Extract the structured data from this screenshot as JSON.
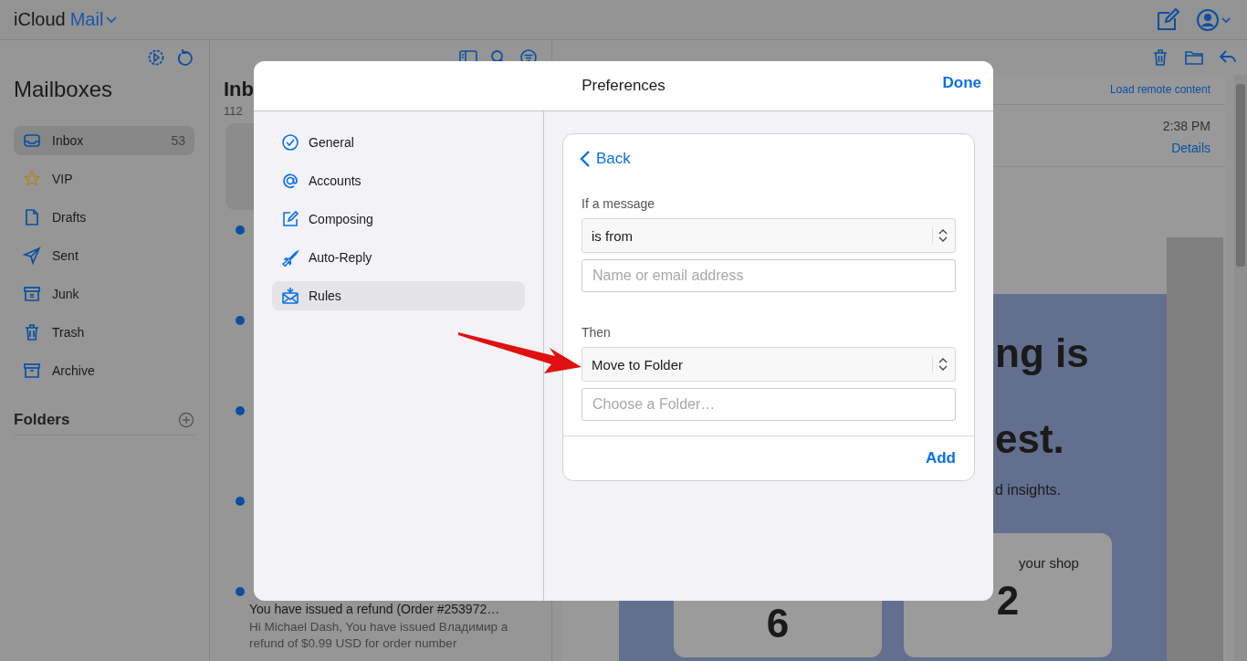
{
  "app": {
    "brand": "iCloud",
    "product": "Mail"
  },
  "sidebar": {
    "title": "Mailboxes",
    "items": [
      {
        "label": "Inbox",
        "kind": "inbox",
        "count": "53",
        "selected": true
      },
      {
        "label": "VIP",
        "kind": "star",
        "selected": false
      },
      {
        "label": "Drafts",
        "kind": "draft",
        "selected": false
      },
      {
        "label": "Sent",
        "kind": "sent",
        "selected": false
      },
      {
        "label": "Junk",
        "kind": "junk",
        "selected": false
      },
      {
        "label": "Trash",
        "kind": "trash",
        "selected": false
      },
      {
        "label": "Archive",
        "kind": "archive",
        "selected": false
      }
    ],
    "folders_title": "Folders"
  },
  "message_list": {
    "title": "Inb",
    "count": "112",
    "messages": [
      {
        "selected": true,
        "unread": false
      },
      {
        "selected": false,
        "unread": true
      },
      {
        "selected": false,
        "unread": true
      },
      {
        "selected": false,
        "unread": true
      },
      {
        "selected": false,
        "unread": true
      },
      {
        "selected": false,
        "unread": true,
        "subject": "You have issued a refund (Order #253972…",
        "preview": "Hi Michael Dash, You have issued Владимир a refund of $0.99 USD for order number"
      }
    ]
  },
  "reader": {
    "load_remote": "Load remote content",
    "time": "2:38 PM",
    "details": "Details",
    "headline_1": "ng is",
    "headline_2": "est.",
    "subline": "d insights.",
    "cards": [
      {
        "value": "6"
      },
      {
        "label": "your shop",
        "value": "2"
      }
    ]
  },
  "preferences": {
    "title": "Preferences",
    "done": "Done",
    "nav": [
      {
        "label": "General",
        "kind": "check",
        "selected": false
      },
      {
        "label": "Accounts",
        "kind": "at",
        "selected": false
      },
      {
        "label": "Composing",
        "kind": "compose",
        "selected": false
      },
      {
        "label": "Auto-Reply",
        "kind": "plane",
        "selected": false
      },
      {
        "label": "Rules",
        "kind": "rules",
        "selected": true
      }
    ],
    "rule": {
      "back": "Back",
      "condition_label": "If a message",
      "condition": "is from",
      "condition_placeholder": "Name or email address",
      "action_label": "Then",
      "action": "Move to Folder",
      "action_placeholder": "Choose a Folder…",
      "add": "Add"
    }
  }
}
